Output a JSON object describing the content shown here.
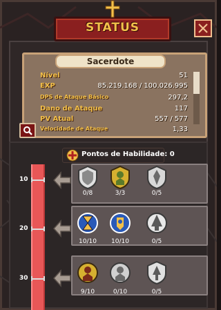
{
  "header": {
    "title": "STATUS"
  },
  "icons": {
    "header": "cross-icon",
    "close": "close-icon",
    "search": "magnifier-icon",
    "points": "skill-point-icon",
    "arrow": "branch-arrow-icon"
  },
  "stats": {
    "character_name": "Sacerdote",
    "rows": [
      {
        "label": "Nível",
        "value": "51"
      },
      {
        "label": "EXP",
        "value": "85.219.168 / 100.026.995"
      },
      {
        "label": "DPS de Ataque Básico",
        "value": "297,2"
      },
      {
        "label": "Dano de Ataque",
        "value": "117"
      },
      {
        "label": "PV Atual",
        "value": "557 / 577"
      },
      {
        "label": "Velocidade de Ataque",
        "value": "1,33"
      }
    ]
  },
  "skill_points": {
    "label": "Pontos de Habilidade: 0",
    "value": 0
  },
  "tree": {
    "tiers": [
      {
        "level": "10",
        "skills": [
          {
            "icon": "shield-skill-icon",
            "count": "0/8",
            "rank": 0,
            "max": 8,
            "state": "locked"
          },
          {
            "icon": "holy-knight-skill-icon",
            "count": "3/3",
            "rank": 3,
            "max": 3,
            "state": "gold"
          },
          {
            "icon": "aura-skill-icon",
            "count": "0/5",
            "rank": 0,
            "max": 5,
            "state": "locked"
          }
        ]
      },
      {
        "level": "20",
        "skills": [
          {
            "icon": "hourglass-skill-icon",
            "count": "10/10",
            "rank": 10,
            "max": 10,
            "state": "blue"
          },
          {
            "icon": "guardian-skill-icon",
            "count": "10/10",
            "rank": 10,
            "max": 10,
            "state": "blue"
          },
          {
            "icon": "spire-skill-icon",
            "count": "0/5",
            "rank": 0,
            "max": 5,
            "state": "locked"
          }
        ]
      },
      {
        "level": "30",
        "skills": [
          {
            "icon": "paladin-skill-icon",
            "count": "9/10",
            "rank": 9,
            "max": 10,
            "state": "gold"
          },
          {
            "icon": "templar-skill-icon",
            "count": "0/10",
            "rank": 0,
            "max": 10,
            "state": "locked"
          },
          {
            "icon": "beacon-skill-icon",
            "count": "0/5",
            "rank": 0,
            "max": 5,
            "state": "locked"
          }
        ]
      }
    ]
  },
  "colors": {
    "banner": "#8a1f1f",
    "title": "#f2c04a",
    "stat_label": "#f2c04a",
    "tree_bar": "#e85757",
    "panel": "#8a7360"
  }
}
